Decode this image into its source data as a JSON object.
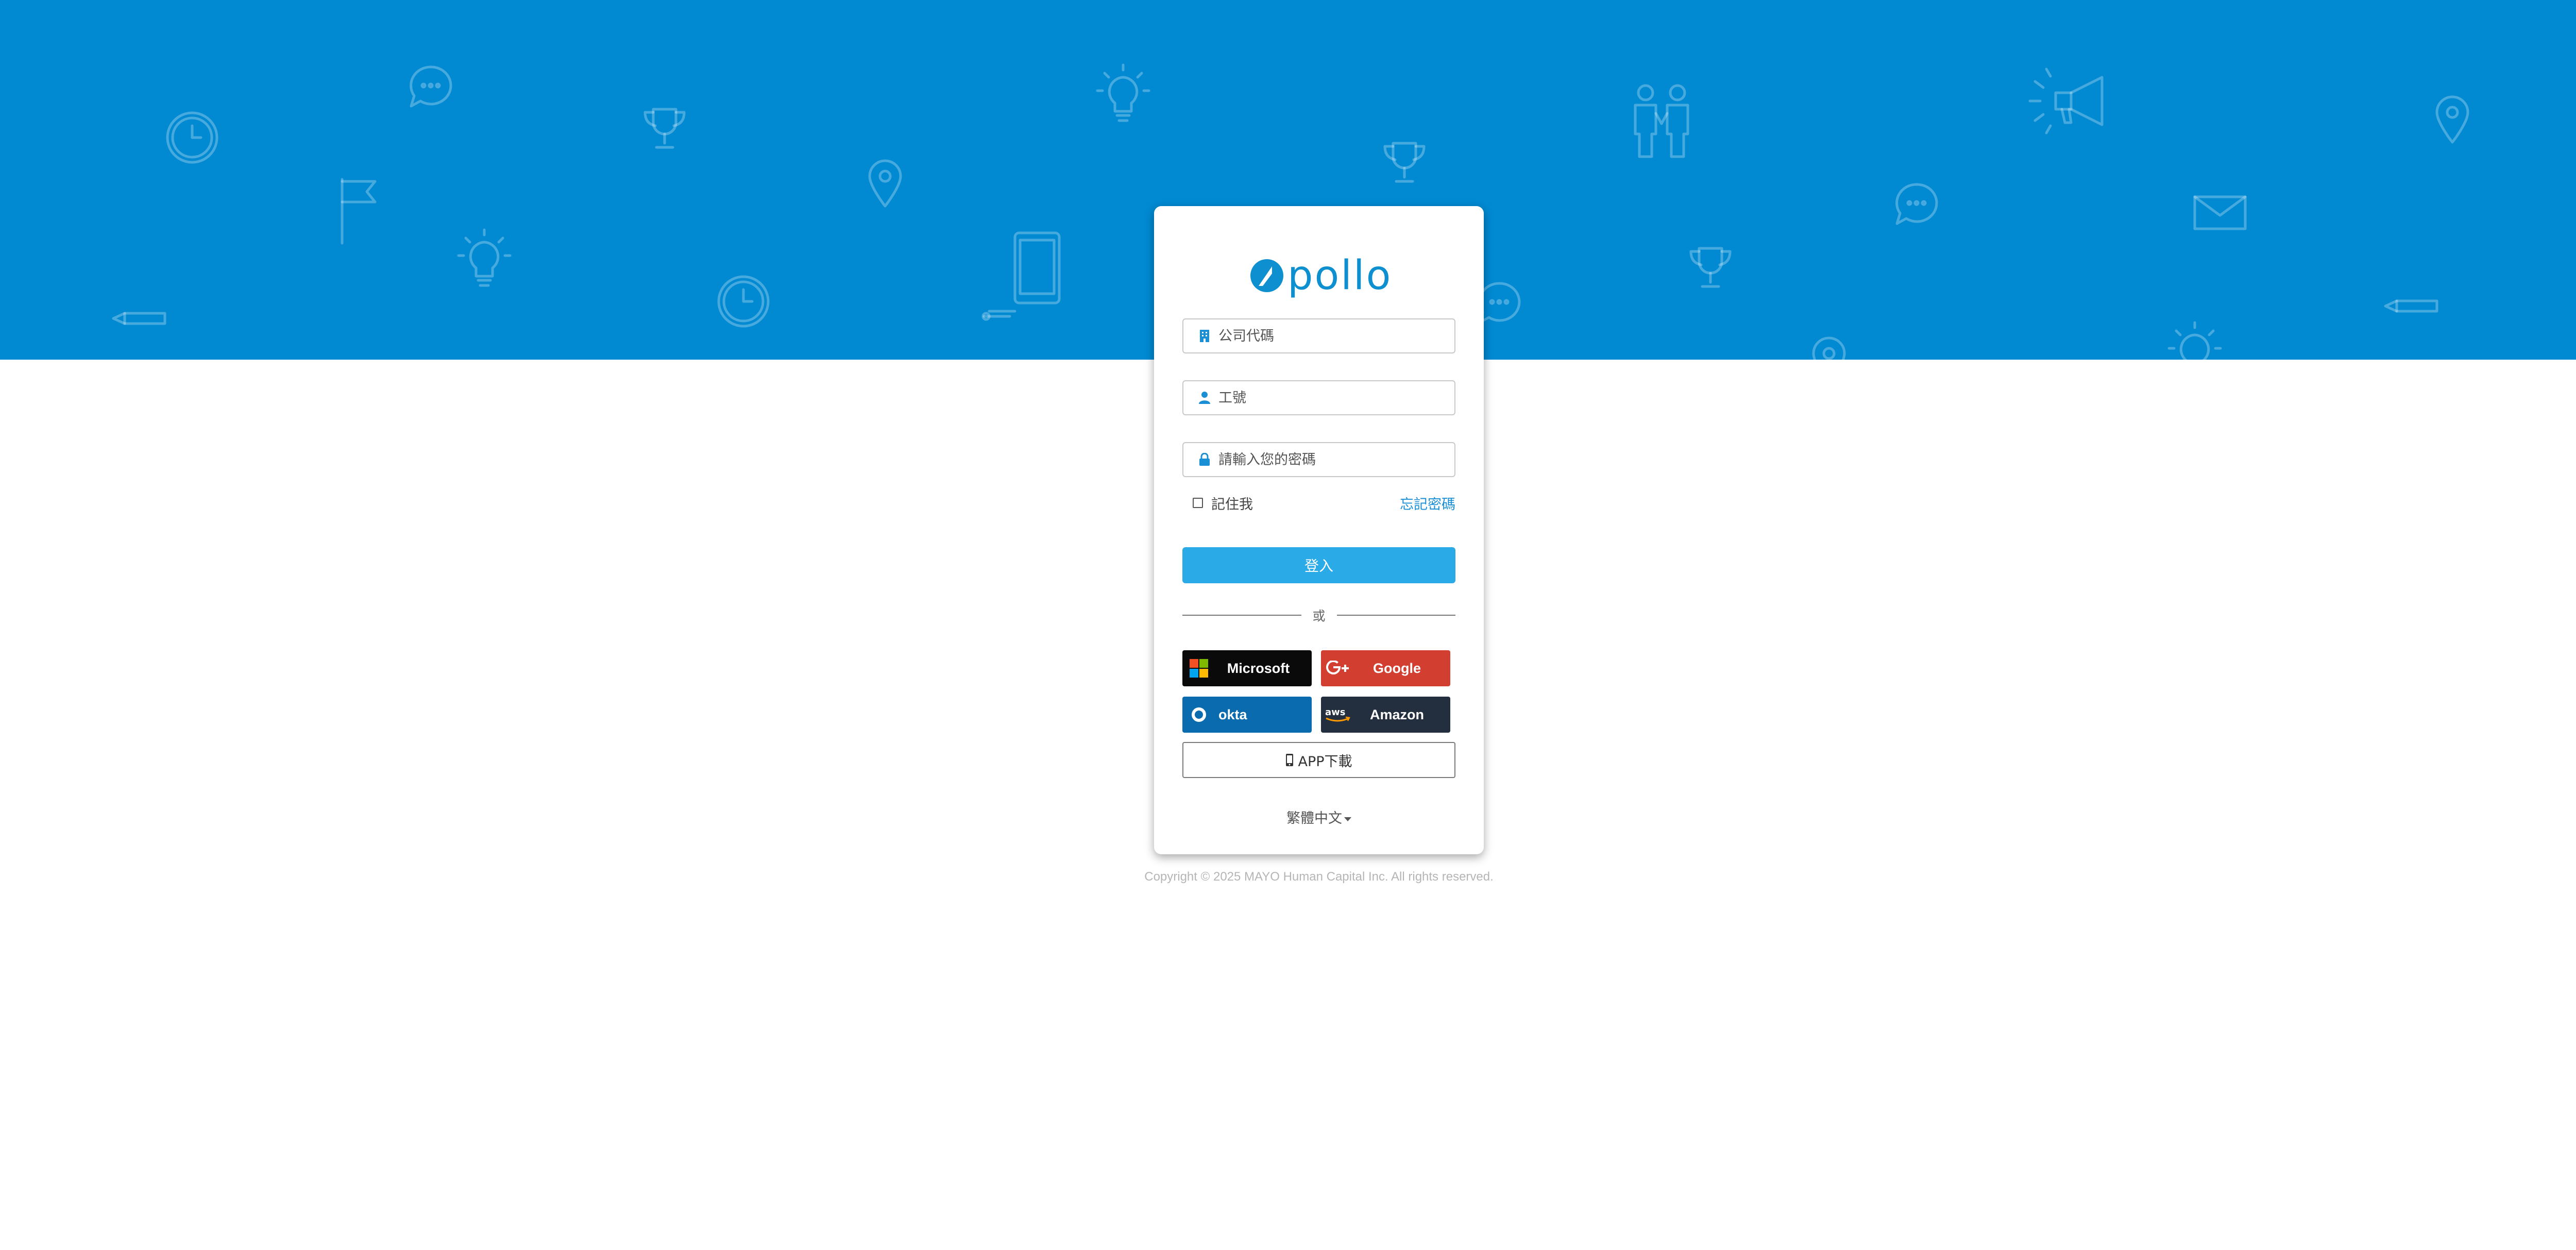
{
  "brand": {
    "logo_text": "pollo",
    "logo_color": "#0e8fd0",
    "banner_color": "#0189d2"
  },
  "form": {
    "company_code": {
      "placeholder": "公司代碼",
      "value": "",
      "icon": "building-icon"
    },
    "employee_id": {
      "placeholder": "工號",
      "value": "",
      "icon": "user-icon"
    },
    "password": {
      "placeholder": "請輸入您的密碼",
      "value": "",
      "icon": "lock-icon"
    },
    "remember_label": "記住我",
    "remember_checked": false,
    "forgot_label": "忘記密碼",
    "login_label": "登入",
    "login_color": "#2aaae6"
  },
  "divider": {
    "or_label": "或"
  },
  "sso": [
    {
      "label": "Microsoft",
      "color": "#0a0a0a",
      "icon": "microsoft-icon"
    },
    {
      "label": "Google",
      "color": "#d23e2f",
      "icon": "google-plus-icon"
    },
    {
      "label": "okta",
      "color": "#0a6cae",
      "icon": "okta-icon"
    },
    {
      "label": "Amazon",
      "color": "#232f3e",
      "icon": "aws-icon"
    }
  ],
  "app_download": {
    "label": "APP下載",
    "icon": "mobile-phone-icon"
  },
  "language": {
    "selected": "繁體中文"
  },
  "footer": {
    "copyright": "Copyright © 2025 MAYO Human Capital Inc. All rights reserved."
  }
}
